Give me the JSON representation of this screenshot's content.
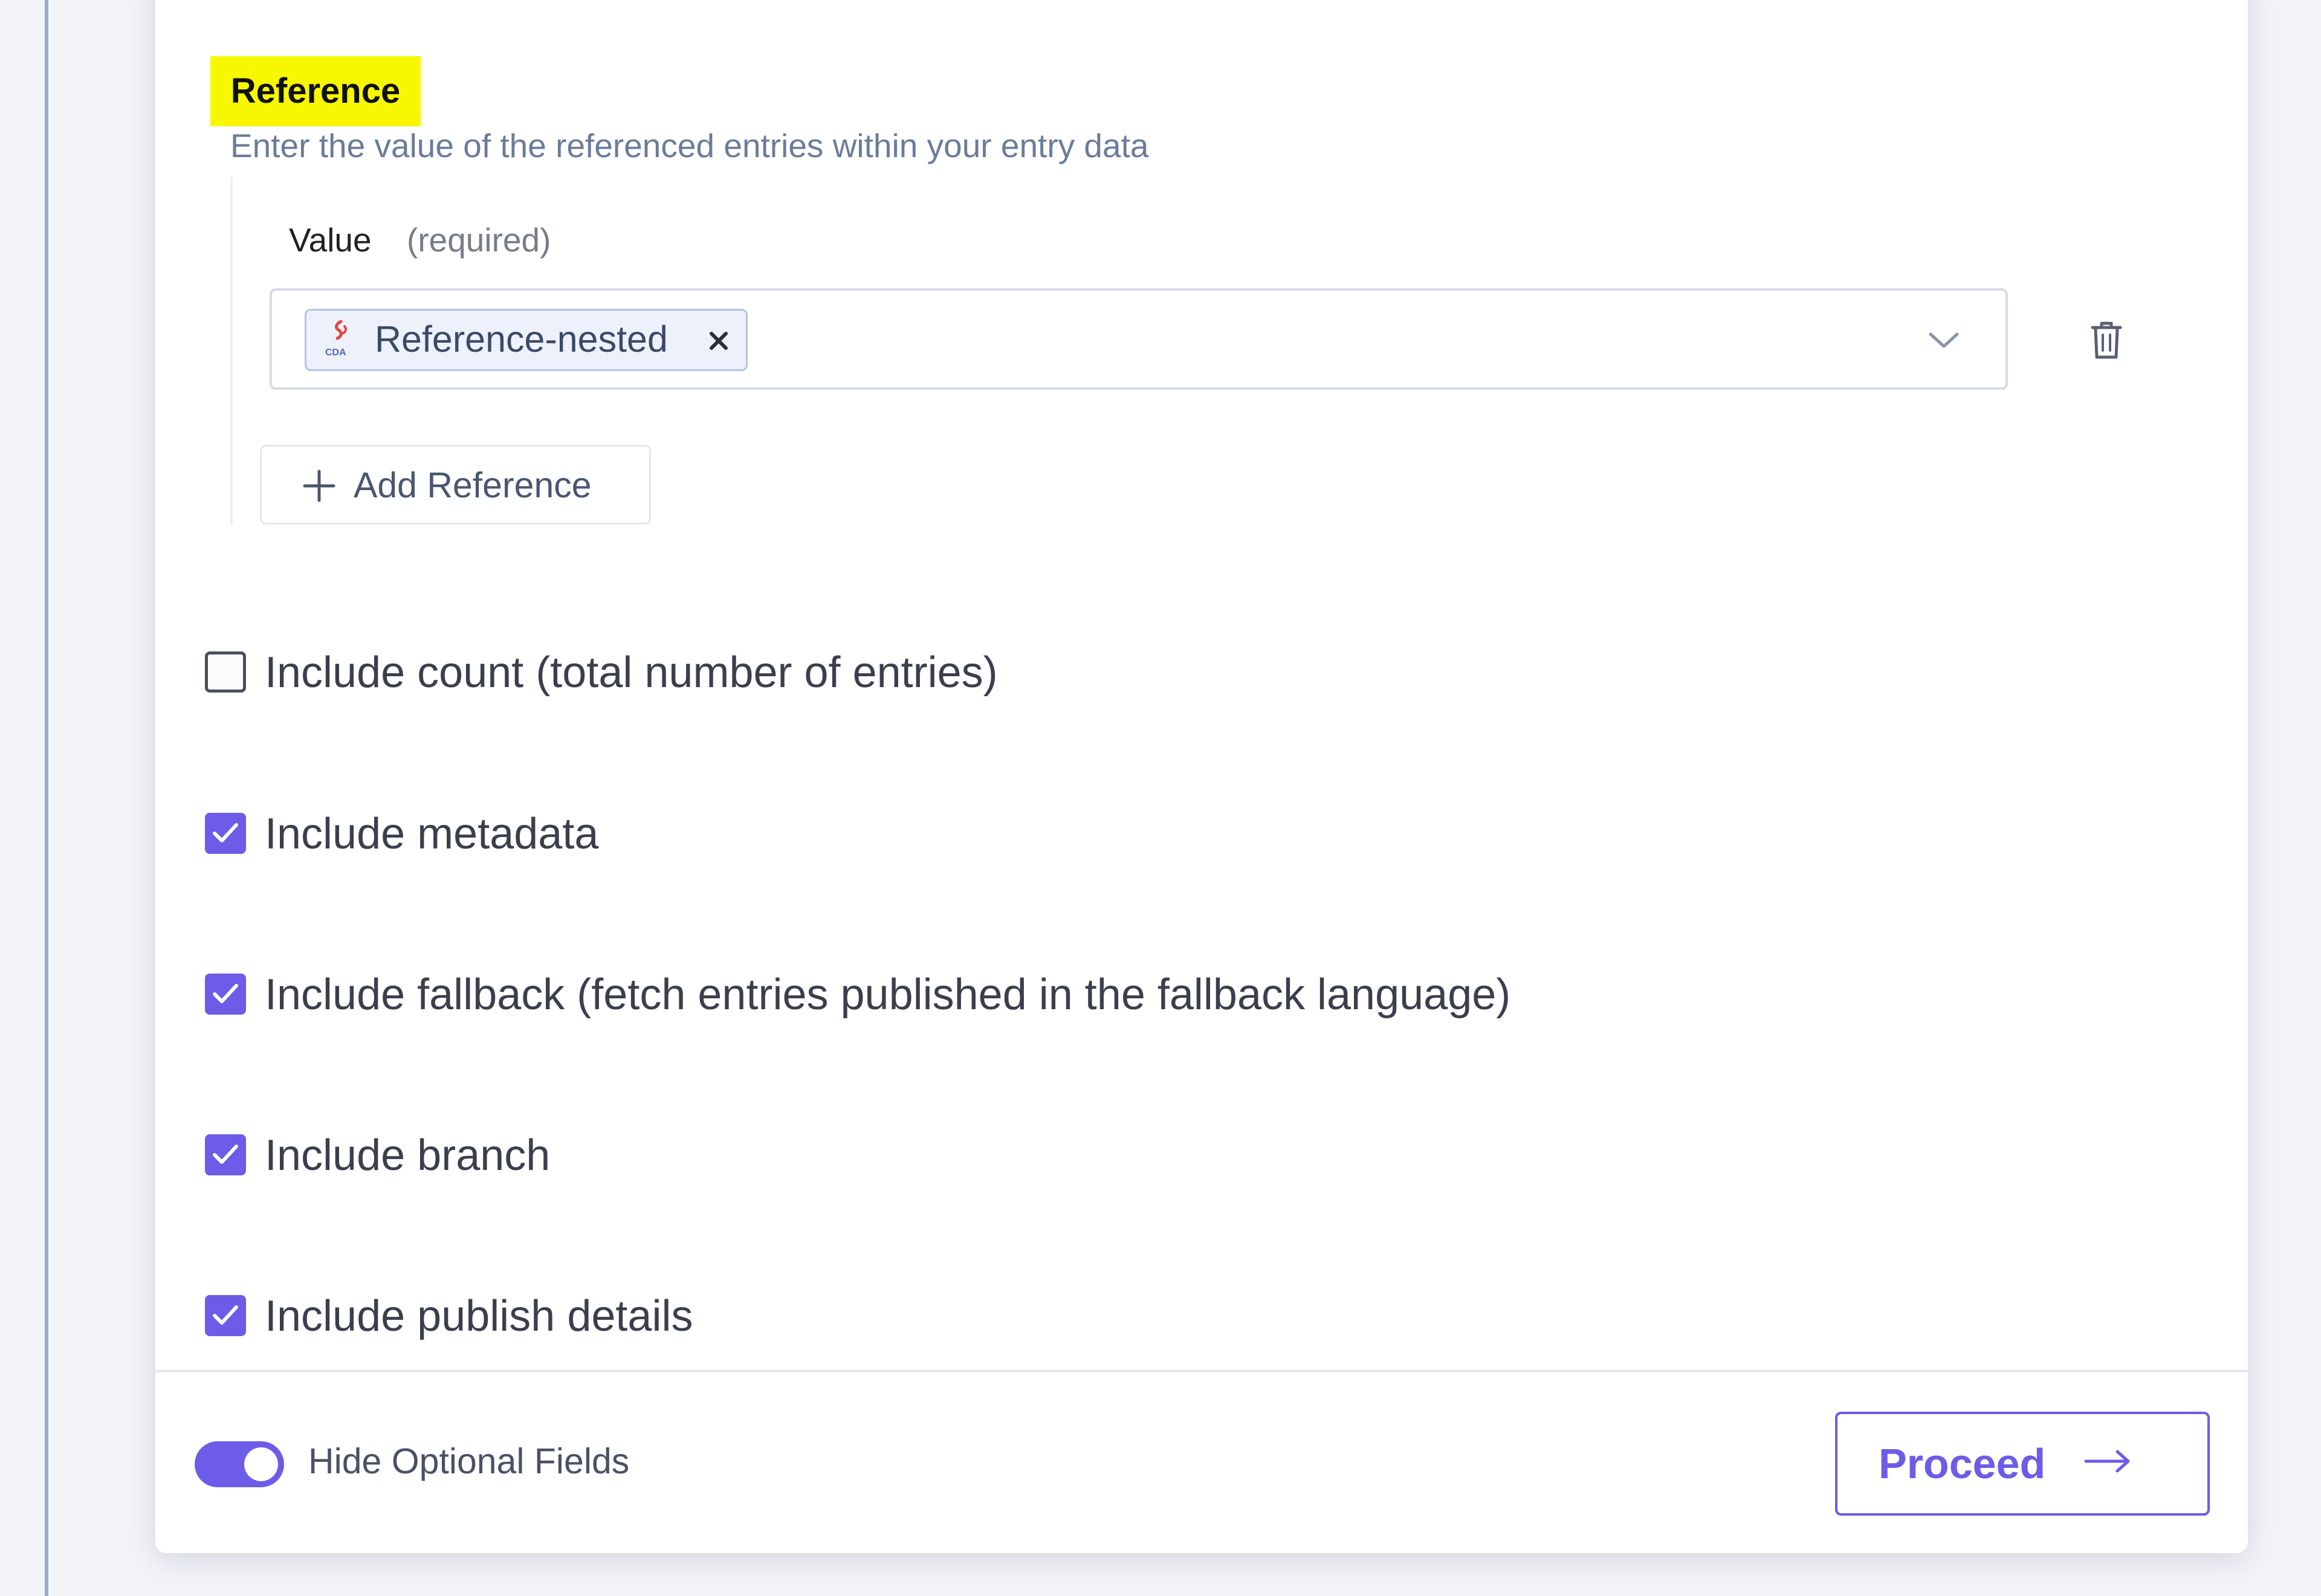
{
  "reference": {
    "title": "Reference",
    "description": "Enter the value of the referenced entries within your entry data",
    "value_label": "Value",
    "value_required": "(required)",
    "selected_chip": {
      "label": "Reference-nested",
      "icon": "contentstack-cda-icon"
    },
    "add_button_label": "Add Reference"
  },
  "options": [
    {
      "label": "Include count (total number of entries)",
      "checked": false
    },
    {
      "label": "Include metadata",
      "checked": true
    },
    {
      "label": "Include fallback (fetch entries published in the fallback language)",
      "checked": true
    },
    {
      "label": "Include branch",
      "checked": true
    },
    {
      "label": "Include publish details",
      "checked": true
    }
  ],
  "footer": {
    "toggle_label": "Hide Optional Fields",
    "toggle_on": true,
    "proceed_label": "Proceed"
  },
  "colors": {
    "accent": "#6c5ce7",
    "highlight": "#f7f700"
  }
}
